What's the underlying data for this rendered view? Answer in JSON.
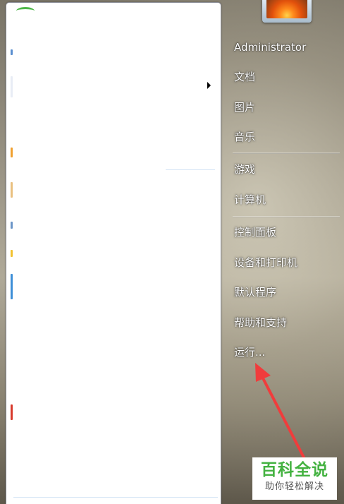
{
  "right_pane": {
    "user_name": "Administrator",
    "items": [
      {
        "label": "文档"
      },
      {
        "label": "图片"
      },
      {
        "label": "音乐"
      },
      {
        "label": "游戏"
      },
      {
        "label": "计算机"
      },
      {
        "label": "控制面板"
      },
      {
        "label": "设备和打印机"
      },
      {
        "label": "默认程序"
      },
      {
        "label": "帮助和支持"
      },
      {
        "label": "运行..."
      }
    ]
  },
  "watermark": {
    "title": "百科全说",
    "subtitle": "助你轻松解决"
  },
  "colors": {
    "annotation_arrow": "#f03c3c",
    "watermark_green": "#44b241"
  }
}
